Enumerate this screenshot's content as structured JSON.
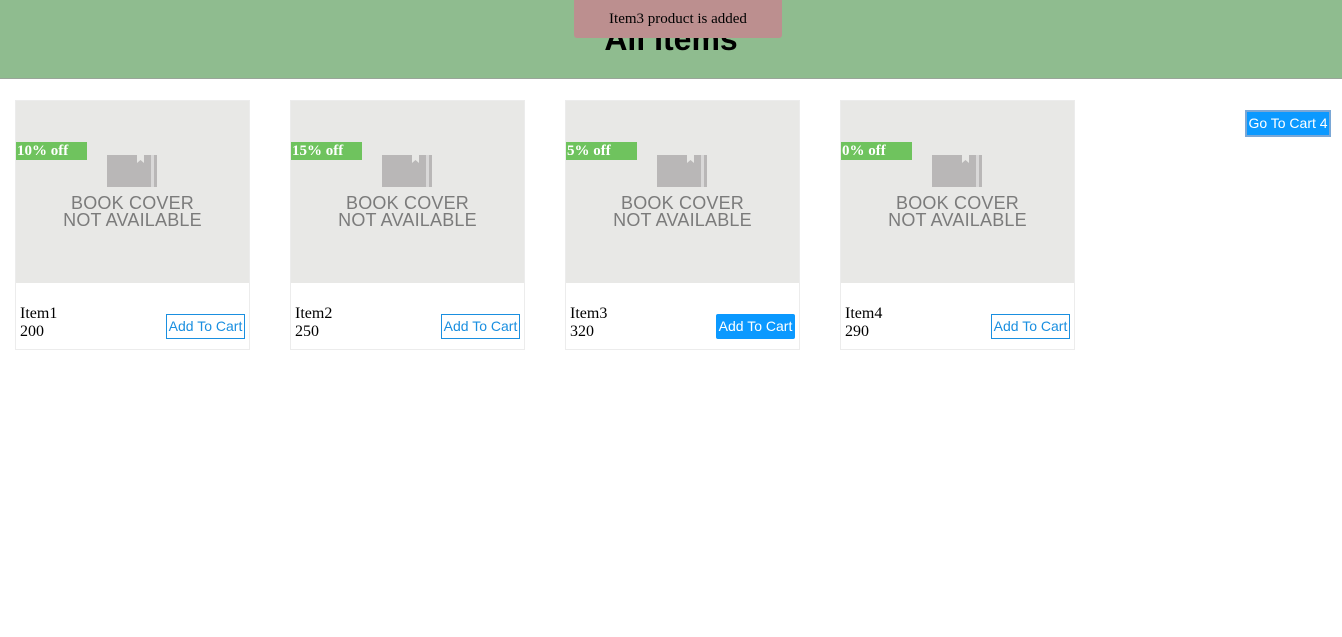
{
  "header": {
    "title": "All Items"
  },
  "toast": {
    "message": "Item3 product is added"
  },
  "cart_button": {
    "label": "Go To Cart 4"
  },
  "cover_placeholder": {
    "line1": "BOOK COVER",
    "line2": "NOT AVAILABLE",
    "icon": "book-icon"
  },
  "products": [
    {
      "discount": "10% off",
      "name": "Item1",
      "price": "200",
      "button_label": "Add To Cart",
      "added": false
    },
    {
      "discount": "15% off",
      "name": "Item2",
      "price": "250",
      "button_label": "Add To Cart",
      "added": false
    },
    {
      "discount": "5% off",
      "name": "Item3",
      "price": "320",
      "button_label": "Add To Cart",
      "added": true
    },
    {
      "discount": "0% off",
      "name": "Item4",
      "price": "290",
      "button_label": "Add To Cart",
      "added": false
    }
  ],
  "colors": {
    "header_bg": "#8fbc8f",
    "toast_bg": "#bc8f8f",
    "discount_bg": "#6fc35e",
    "accent": "#0b99ff"
  }
}
